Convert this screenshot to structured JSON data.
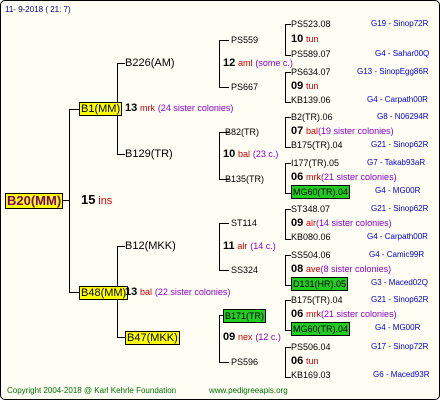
{
  "header": {
    "date": "11-   9-2018  (  21:   7)"
  },
  "footer": {
    "copyright": "Copyright 2004-2018 @ Karl Kehrle Foundation",
    "url": "www.pedigreeapis.org"
  },
  "root": {
    "id": "B20(MM)",
    "gen": "15",
    "suffix": "ins"
  },
  "mid": {
    "top": {
      "id": "B1(MM)"
    },
    "bottom": {
      "id": "B48(MM)"
    }
  },
  "gen13": {
    "a": {
      "gen": "13",
      "type": "mrk",
      "sis": "(24 sister colonies)"
    },
    "b": {
      "gen": "13",
      "type": "bal",
      "sis": "(22 sister colonies)"
    }
  },
  "fourth": {
    "b226": {
      "id": "B226(AM)"
    },
    "b129": {
      "id": "B129(TR)"
    },
    "b12": {
      "id": "B12(MKK)"
    },
    "b47": {
      "id": "B47(MKK)"
    }
  },
  "mid5": {
    "m12": {
      "gen": "12",
      "type": "aml",
      "sis": "(some c.)"
    },
    "m10": {
      "gen": "10",
      "type": "bal",
      "sis": "(23 c.)"
    },
    "m11": {
      "gen": "11",
      "type": "alr",
      "sis": "(14 c.)"
    },
    "m09": {
      "gen": "09",
      "type": "nex",
      "sis": "(12 c.)"
    }
  },
  "fifth": {
    "ps559": "PS559",
    "ps667": "PS667",
    "b82": "B82(TR)",
    "b135": "B135(TR)",
    "st114": "ST114",
    "ss324": "SS324",
    "b171": "B171(TR)",
    "ps596": "PS596"
  },
  "cols6": {
    "r1": {
      "name": "PS523.08",
      "tag": "G19 - Sinop72R"
    },
    "r2": {
      "gen": "10",
      "type": "tun"
    },
    "r3": {
      "name": "PS589.07",
      "tag": "G4 - Sahar00Q"
    },
    "r4": {
      "name": "PS634.07",
      "tag": "G13 - SinopEgg86R"
    },
    "r5": {
      "gen": "09",
      "type": "tun"
    },
    "r6": {
      "name": "KB139.06",
      "tag": "G4 - Carpath00R"
    },
    "r7": {
      "name": "B2(TR).06",
      "tag": "G8 - N06294R"
    },
    "r8": {
      "gen": "07",
      "type": "bal",
      "sis": "(19 sister colonies)"
    },
    "r9": {
      "name": "B175(TR).04",
      "tag": "G21 - Sinop62R"
    },
    "r10": {
      "name": "I177(TR).05",
      "tag": "G7 - Takab93aR"
    },
    "r11": {
      "gen": "06",
      "type": "mrk",
      "sis": "(21 sister colonies)"
    },
    "r12": {
      "name": "MG60(TR).04",
      "tag": "G4 - MG00R"
    },
    "r13": {
      "name": "ST348.07",
      "tag": "G21 - Sinop62R"
    },
    "r14": {
      "gen": "09",
      "type": "alr",
      "sis": "(14 sister colonies)"
    },
    "r15": {
      "name": "KB080.06",
      "tag": "G4 - Carpath00R"
    },
    "r16": {
      "name": "SS504.06",
      "tag": "G4 - Camic99R"
    },
    "r17": {
      "gen": "08",
      "type": "ave",
      "sis": "(8 sister colonies)"
    },
    "r18": {
      "name": "D131(HR).05",
      "tag": "G3 - Maced02Q"
    },
    "r19": {
      "name": "B175(TR).04",
      "tag": "G21 - Sinop62R"
    },
    "r20": {
      "gen": "06",
      "type": "mrk",
      "sis": "(21 sister colonies)"
    },
    "r21": {
      "name": "MG60(TR).04",
      "tag": "G4 - MG00R"
    },
    "r22": {
      "name": "PS506.04",
      "tag": "G17 - Sinop72R"
    },
    "r23": {
      "gen": "06",
      "type": "tun"
    },
    "r24": {
      "name": "KB169.03",
      "tag": "G6 - Maced93R"
    }
  }
}
